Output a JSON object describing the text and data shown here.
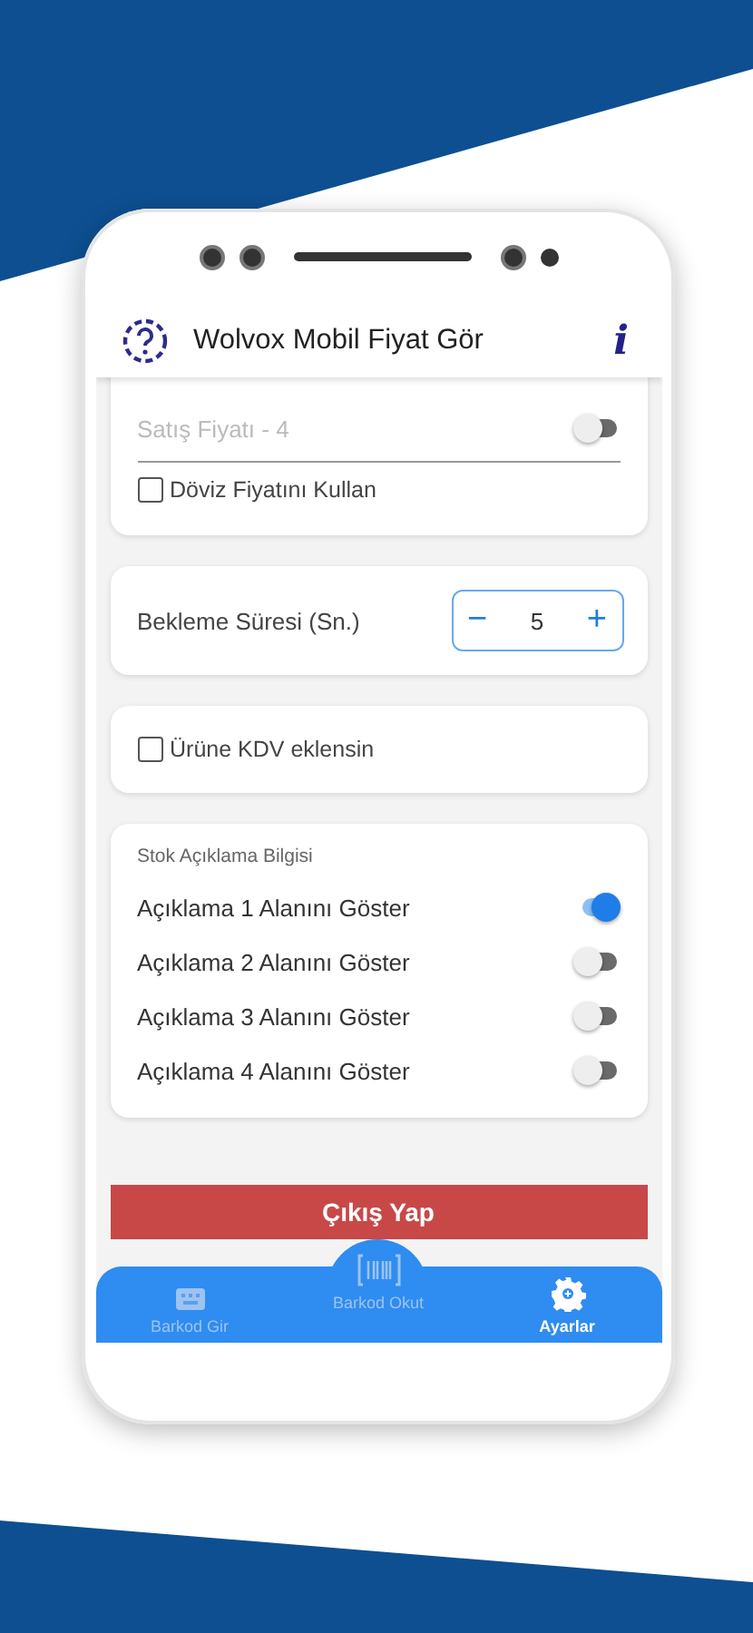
{
  "app_bar": {
    "title": "Wolvox Mobil Fiyat Gör",
    "info": "i"
  },
  "price_card": {
    "rows": [
      {
        "label": "Satış Fiyatı - 4",
        "on": false,
        "disabled": true
      }
    ],
    "currency_checkbox": {
      "label": "Döviz Fiyatını Kullan",
      "checked": false
    }
  },
  "wait_card": {
    "label": "Bekleme Süresi (Sn.)",
    "minus": "−",
    "value": "5",
    "plus": "+"
  },
  "vat_checkbox": {
    "label": "Ürüne KDV eklensin",
    "checked": false
  },
  "stock_card": {
    "title": "Stok Açıklama Bilgisi",
    "toggles": [
      {
        "label": "Açıklama 1 Alanını Göster",
        "on": true
      },
      {
        "label": "Açıklama 2 Alanını Göster",
        "on": false
      },
      {
        "label": "Açıklama 3 Alanını Göster",
        "on": false
      },
      {
        "label": "Açıklama 4 Alanını Göster",
        "on": false
      }
    ]
  },
  "exit_button": "Çıkış Yap",
  "bottom_nav": [
    {
      "label": "Barkod Gir",
      "kind": "keyboard",
      "selected": false
    },
    {
      "label": "Barkod Okut",
      "kind": "barcode",
      "selected": false
    },
    {
      "label": "Ayarlar",
      "kind": "gear",
      "selected": true
    }
  ]
}
